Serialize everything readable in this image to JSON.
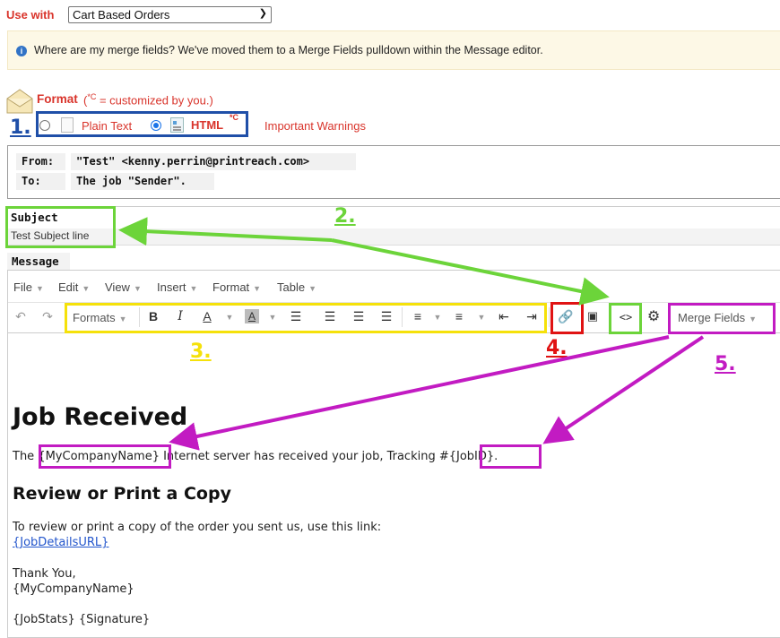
{
  "use_with": {
    "label": "Use with",
    "selected": "Cart Based Orders"
  },
  "info": {
    "icon": "info-circle-icon",
    "text": "Where are my merge fields? We've moved them to a Merge Fields pulldown within the Message editor."
  },
  "format": {
    "label": "Format",
    "note_prefix": "(",
    "note_sup": "*C",
    "note_suffix": " = customized by you.)",
    "plain_text_label": "Plain Text",
    "html_label": "HTML",
    "html_sup": "*C",
    "warnings_link": "Important Warnings",
    "selected": "HTML"
  },
  "header_fields": {
    "from_key": "From:",
    "from_value": "\"Test\" <kenny.perrin@printreach.com>",
    "to_key": "To:",
    "to_value": "The job \"Sender\"."
  },
  "subject": {
    "label": "Subject",
    "value": "Test Subject line"
  },
  "message": {
    "label": "Message",
    "menubar": [
      "File",
      "Edit",
      "View",
      "Insert",
      "Format",
      "Table"
    ],
    "toolbar": {
      "formats_label": "Formats",
      "merge_fields_label": "Merge Fields"
    },
    "content": {
      "heading": "Job Received",
      "para1_start": "The ",
      "company_field": "{MyCompanyName}",
      "para1_mid": " Internet server has received your job, Tracking #",
      "jobid_field": "{JobID}",
      "para1_end": ".",
      "subheading": "Review or Print a Copy",
      "para2": "To review or print a copy of the order you sent us, use this link:",
      "details_link": "{JobDetailsURL}",
      "thanks": "Thank You,",
      "thanks_company": "{MyCompanyName}",
      "stats_signature": "{JobStats} {Signature}"
    }
  },
  "annotations": {
    "n1": "1.",
    "n2": "2.",
    "n3": "3.",
    "n4": "4.",
    "n5": "5."
  },
  "colors": {
    "blue_box": "#1f4fa8",
    "green_box": "#6cd43a",
    "yellow_box": "#f5e10a",
    "red_box": "#e01313",
    "magenta_box": "#c21bc2",
    "label_red": "#d9342b"
  }
}
